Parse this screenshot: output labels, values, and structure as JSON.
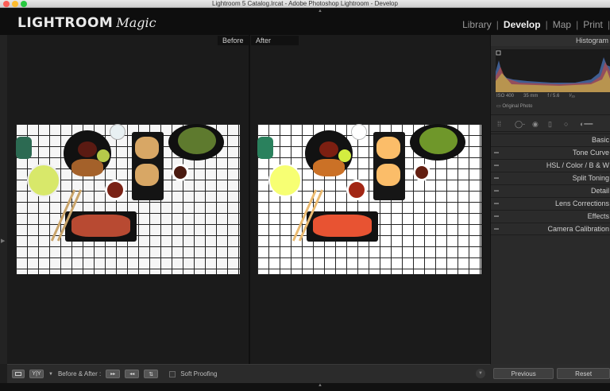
{
  "window": {
    "title": "Lightroom 5 Catalog.lrcat - Adobe Photoshop Lightroom - Develop"
  },
  "brand": {
    "main": "LIGHTROOM",
    "script": "Magic"
  },
  "modules": [
    {
      "label": "Library"
    },
    {
      "label": "Develop"
    },
    {
      "label": "Map"
    },
    {
      "label": "Print"
    }
  ],
  "view": {
    "before_label": "Before",
    "after_label": "After"
  },
  "toolbar": {
    "before_after_label": "Before & After :",
    "soft_proofing_label": "Soft Proofing",
    "yy_label": "Y|Y"
  },
  "right_panel": {
    "histogram_title": "Histogram",
    "exif": {
      "iso": "ISO 400",
      "focal": "35 mm",
      "aperture": "f / 5.6",
      "shutter": "¹⁄₁₆"
    },
    "original_photo_label": "Original Photo",
    "sections": [
      {
        "label": "Basic"
      },
      {
        "label": "Tone Curve"
      },
      {
        "label": "HSL  /  Color  /  B & W"
      },
      {
        "label": "Split Toning"
      },
      {
        "label": "Detail"
      },
      {
        "label": "Lens Corrections"
      },
      {
        "label": "Effects"
      },
      {
        "label": "Camera Calibration"
      }
    ],
    "previous_label": "Previous",
    "reset_label": "Reset"
  },
  "colors": {
    "accent": "#f0f0f0",
    "panel": "#2a2a2a",
    "stage": "#1b1b1b"
  }
}
